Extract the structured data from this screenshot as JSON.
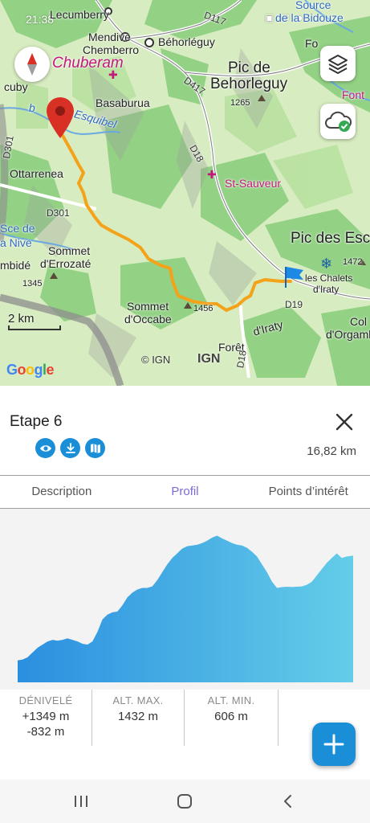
{
  "status_bar": {
    "time": "21:38"
  },
  "map": {
    "labels": {
      "lecumberry": "Lecumberry",
      "mendive": "Mendive",
      "chemberro": "Chemberro",
      "behorleguy": "Béhorléguy",
      "d117": "D117",
      "source": "Source",
      "bidouze": "de la Bidouze",
      "fo": "Fo",
      "chuberam": "Chuberam",
      "lecuby": "cuby",
      "basaburua": "Basaburua",
      "pic_de": "Pic de",
      "behorleguy_pic": "Behorleguy",
      "d417": "D417",
      "alt1265": "1265",
      "font": "Font",
      "eb": "b",
      "esquibel": "Esquibel",
      "d301a": "D301",
      "ottarrenea": "Ottarrenea",
      "d18a": "D18",
      "st_sauveur": "St-Sauveur",
      "d301b": "D301",
      "sce_de": "Sce de",
      "nive": "a Nive",
      "sommet_erro1": "Sommet",
      "sommet_erro2": "d'Errozaté",
      "mbide": "mbidé",
      "alt1345": "1345",
      "pic_des": "Pic des Esc",
      "alt1472": "1472",
      "chalets1": "les Chalets",
      "chalets2": "d'Iraty",
      "d19": "D19",
      "sommet_occ1": "Sommet",
      "sommet_occ2": "d'Occabe",
      "alt1456": "1456",
      "foret": "Forêt",
      "iraty": "d'Iraty",
      "d18b": "D18",
      "col": "Col",
      "orgambi": "d'Orgambi"
    },
    "scale_label": "2 km",
    "attribution": {
      "google": [
        "G",
        "o",
        "o",
        "g",
        "l",
        "e"
      ],
      "ign_text": "© IGN",
      "ign_logo": "IGN"
    },
    "buttons": {
      "compass": "compass-icon",
      "layers": "layers-icon",
      "offline": "cloud-check-icon"
    },
    "colors": {
      "route": "#f5a21b",
      "start_marker": "#d93025",
      "end_flag": "#1e88e5"
    }
  },
  "panel": {
    "title": "Etape 6",
    "distance": "16,82 km",
    "actions": [
      {
        "icon": "eye-icon"
      },
      {
        "icon": "download-icon"
      },
      {
        "icon": "map-icon"
      }
    ],
    "tabs": [
      {
        "label": "Description",
        "active": false
      },
      {
        "label": "Profil",
        "active": true
      },
      {
        "label": "Points d’intérêt",
        "active": false
      }
    ],
    "stats": [
      {
        "label": "DÉNIVELÉ",
        "values": [
          "+1349 m",
          "-832 m"
        ]
      },
      {
        "label": "ALT. MAX.",
        "values": [
          "1432 m"
        ]
      },
      {
        "label": "ALT. MIN.",
        "values": [
          "606 m"
        ]
      }
    ]
  },
  "chart_data": {
    "type": "area",
    "title": "",
    "xlabel": "",
    "ylabel": "",
    "x": [
      0,
      0.25,
      0.5,
      0.75,
      1,
      1.25,
      1.5,
      1.75,
      2,
      2.25,
      2.5,
      2.75,
      3,
      3.25,
      3.5,
      3.75,
      4,
      4.25,
      4.5,
      4.75,
      5,
      5.25,
      5.5,
      5.75,
      6,
      6.25,
      6.5,
      6.75,
      7,
      7.25,
      7.5,
      7.75,
      8,
      8.25,
      8.5,
      8.75,
      9,
      9.25,
      9.5,
      9.75,
      10,
      10.25,
      10.5,
      10.75,
      11,
      11.25,
      11.5,
      11.75,
      12,
      12.25,
      12.5,
      12.75,
      13,
      13.25,
      13.5,
      13.75,
      14,
      14.25,
      14.5,
      14.75,
      15,
      15.25,
      15.5,
      15.75,
      16,
      16.25,
      16.5,
      16.82
    ],
    "series": [
      {
        "values": [
          640,
          645,
          660,
          690,
          720,
          740,
          760,
          770,
          765,
          770,
          780,
          770,
          760,
          745,
          740,
          760,
          820,
          900,
          930,
          945,
          950,
          990,
          1040,
          1070,
          1090,
          1100,
          1100,
          1110,
          1150,
          1200,
          1250,
          1290,
          1320,
          1350,
          1365,
          1370,
          1375,
          1385,
          1400,
          1420,
          1432,
          1415,
          1400,
          1385,
          1375,
          1370,
          1355,
          1330,
          1300,
          1250,
          1200,
          1140,
          1100,
          1105,
          1108,
          1106,
          1108,
          1110,
          1120,
          1140,
          1180,
          1220,
          1260,
          1290,
          1320,
          1290,
          1300,
          1305
        ]
      }
    ],
    "ylim": [
      500,
      1450
    ],
    "grid": false,
    "legend": "none",
    "fill": {
      "from": "#2b8fe0",
      "to": "#64cde8"
    }
  },
  "fab": {
    "icon": "plus-icon"
  },
  "nav_bar": {
    "items": [
      "recents-icon",
      "home-icon",
      "back-icon"
    ]
  }
}
